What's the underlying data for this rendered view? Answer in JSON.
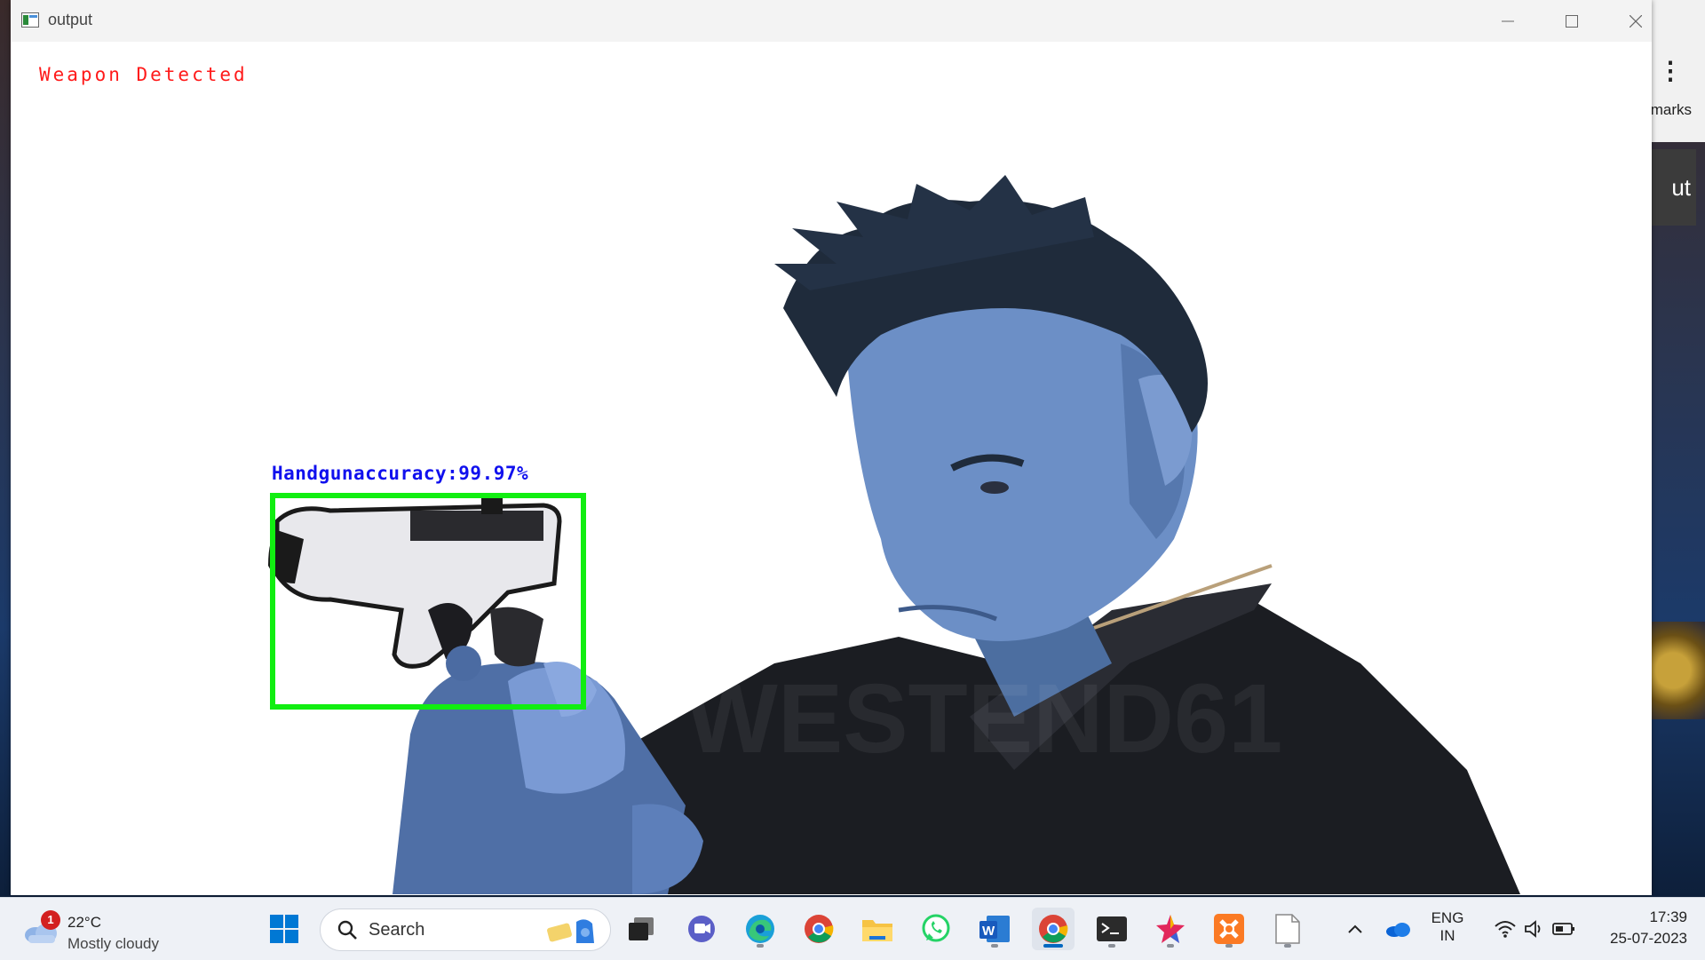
{
  "window": {
    "title": "output",
    "buttons": [
      "minimize",
      "maximize",
      "close"
    ]
  },
  "overlay": {
    "alert_text": "Weapon Detected",
    "detection_label": "Handgunaccuracy:99.97%",
    "box_color": "#11ee11",
    "label_color": "#1010ee",
    "alert_color": "#ff1a1a"
  },
  "background_browser": {
    "partial_text": "marks",
    "partial_button_text": "ut"
  },
  "taskbar": {
    "weather": {
      "badge": "1",
      "temperature": "22°C",
      "condition": "Mostly cloudy"
    },
    "search_placeholder": "Search",
    "apps": [
      {
        "name": "start-icon"
      },
      {
        "name": "task-view-icon"
      },
      {
        "name": "teams-chat-icon"
      },
      {
        "name": "edge-icon"
      },
      {
        "name": "chrome-icon"
      },
      {
        "name": "file-explorer-icon"
      },
      {
        "name": "whatsapp-icon"
      },
      {
        "name": "word-icon"
      },
      {
        "name": "chrome-active-icon"
      },
      {
        "name": "terminal-icon"
      },
      {
        "name": "star-app-icon"
      },
      {
        "name": "xampp-icon"
      },
      {
        "name": "blank-file-icon"
      }
    ],
    "tray": {
      "language_top": "ENG",
      "language_bottom": "IN",
      "time": "17:39",
      "date": "25-07-2023"
    }
  }
}
